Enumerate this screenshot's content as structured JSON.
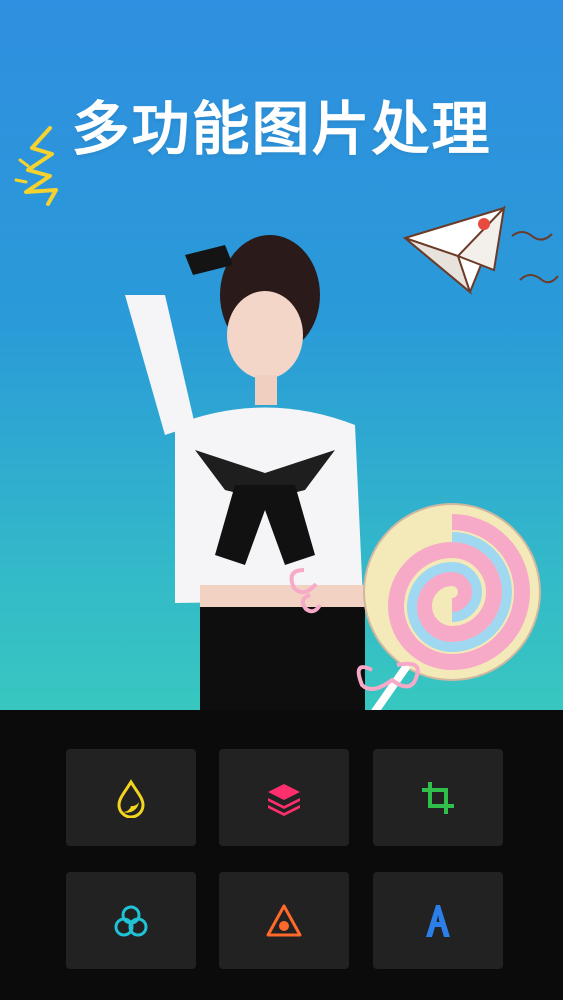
{
  "hero": {
    "title": "多功能图片处理"
  },
  "tools": [
    {
      "icon": "droplet-icon",
      "color": "#f2d51f"
    },
    {
      "icon": "layers-icon",
      "color": "#ff2f6e"
    },
    {
      "icon": "crop-icon",
      "color": "#2fbf4a"
    },
    {
      "icon": "color-circles-icon",
      "color": "#20c3d6"
    },
    {
      "icon": "triangle-point-icon",
      "color": "#ff6a2b"
    },
    {
      "icon": "letter-a-icon",
      "color": "#2a7fe8"
    }
  ]
}
